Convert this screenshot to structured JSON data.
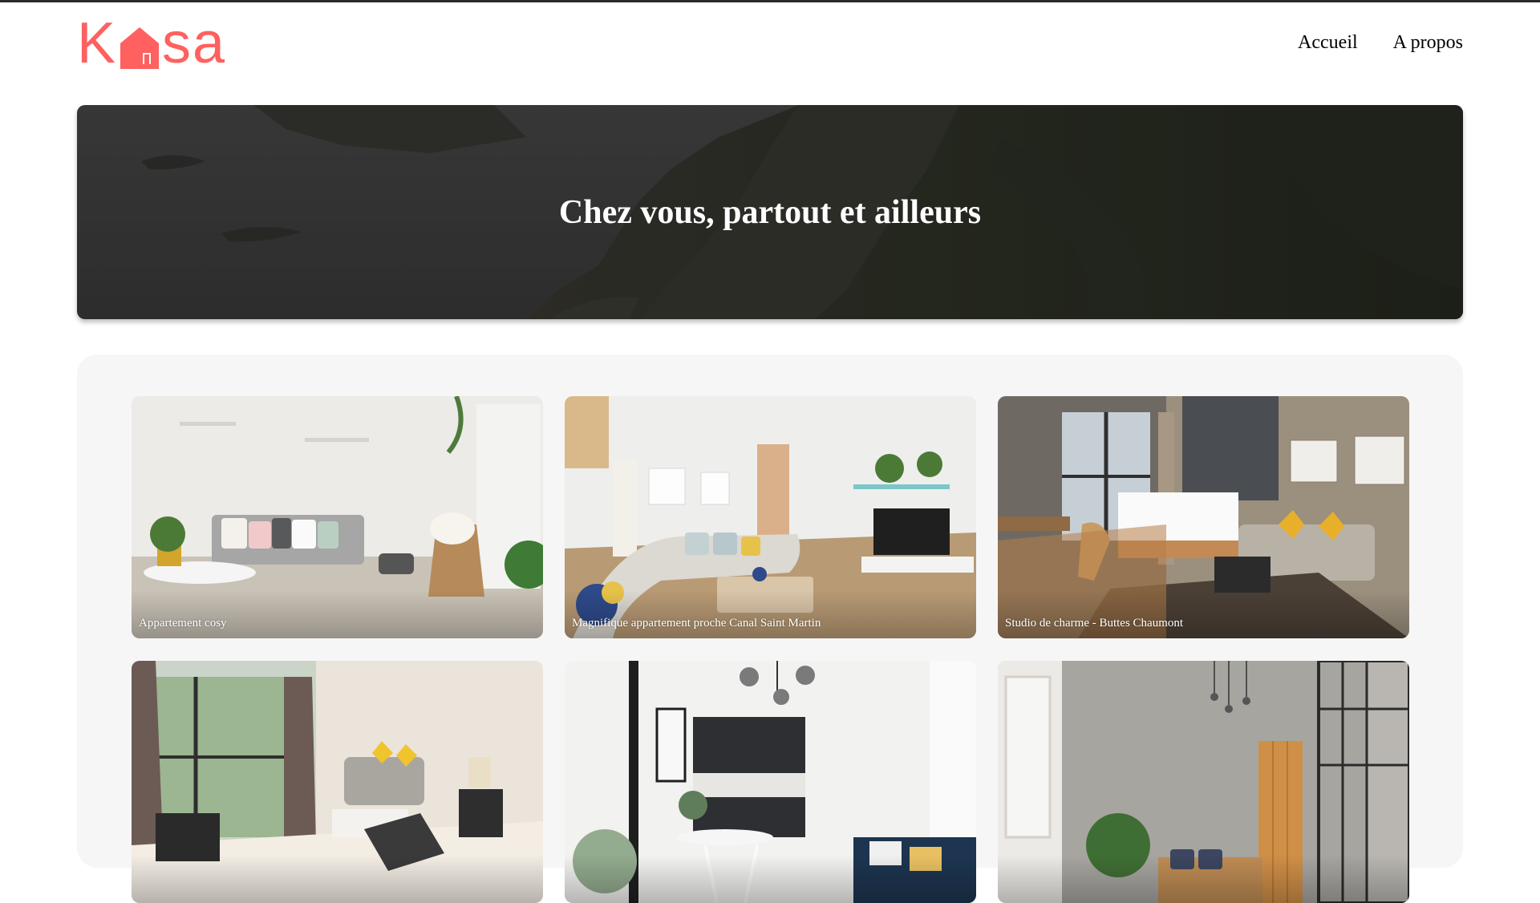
{
  "brand": {
    "logo_left": "K",
    "logo_right": "sa",
    "color": "#ff6060"
  },
  "nav": {
    "items": [
      {
        "label": "Accueil"
      },
      {
        "label": "A propos"
      }
    ]
  },
  "banner": {
    "title": "Chez vous, partout et ailleurs"
  },
  "listings": [
    {
      "title": "Appartement cosy"
    },
    {
      "title": "Magnifique appartement proche Canal Saint Martin"
    },
    {
      "title": "Studio de charme - Buttes Chaumont"
    },
    {
      "title": ""
    },
    {
      "title": ""
    },
    {
      "title": ""
    }
  ]
}
